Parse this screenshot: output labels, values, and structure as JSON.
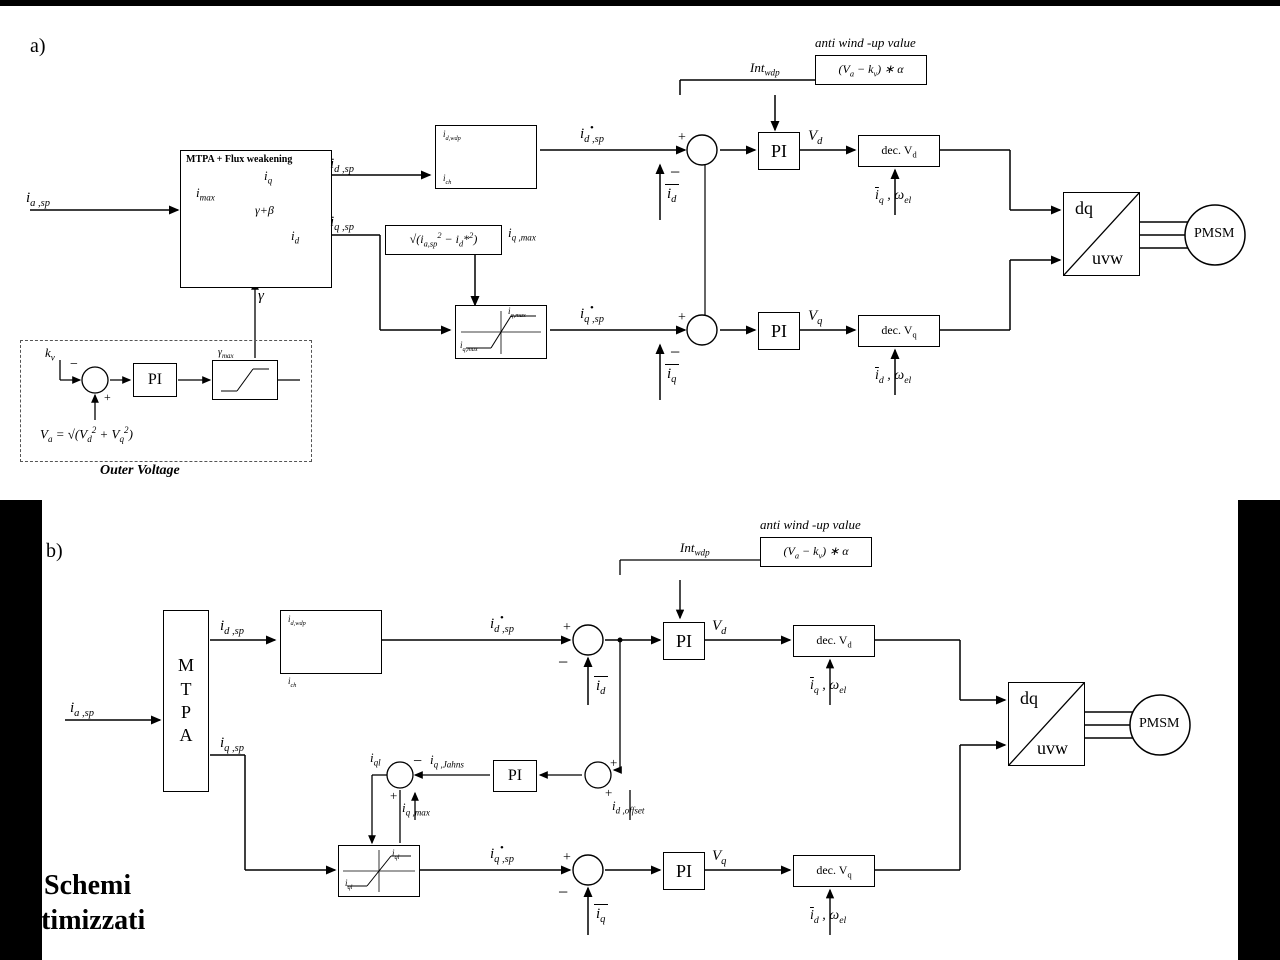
{
  "meta": {
    "title_a": "a)",
    "title_b": "b)"
  },
  "inputs": {
    "ia_sp": "iₐ,ₛₚ"
  },
  "labels": {
    "mtpa_flux": "MTPA + Flux weakening",
    "id": "i_d",
    "iq": "i_q",
    "imax": "i_max",
    "gamma": "γ",
    "beta": "β",
    "id_sp": "i_d ,sp",
    "iq_sp": "i_q ,sp",
    "id_sp_star": "i_d ,sp",
    "iq_sp_star": "i_q ,sp",
    "iq_max": "i_q , max",
    "id_ch": "i_ch",
    "limit_formula": "√(i²ₐ,ₛₚ − i*²_d)",
    "PI": "PI",
    "Vd": "V_d",
    "Vq": "V_q",
    "decVd": "dec. V_d",
    "decVq": "dec. V_q",
    "iq_wel": "ī_q , ω_el",
    "id_wel": "ī_d , ω_el",
    "id_bar": "ī_d",
    "iq_bar": "ī_q",
    "dq": "dq",
    "uvw": "uvw",
    "pmsm": "PMSM",
    "antiwind": "anti wind -up value",
    "antiwind2": "(Vₐ − kᵥ) ∗ α",
    "intwdp": "Int_wdp",
    "kv": "k_v",
    "Va_formula": "Vₐ = √(V²_d + V²_q)",
    "outerV": "Outer Voltage",
    "gamma_max": "γ_max",
    "mtpa": "MTPA",
    "iq_johns": "i_q ,Jahns",
    "id_offset": "i_d ,offset",
    "iql": "i_ql",
    "schemi": "Schemi",
    "ottim": "Ottimizzati"
  }
}
